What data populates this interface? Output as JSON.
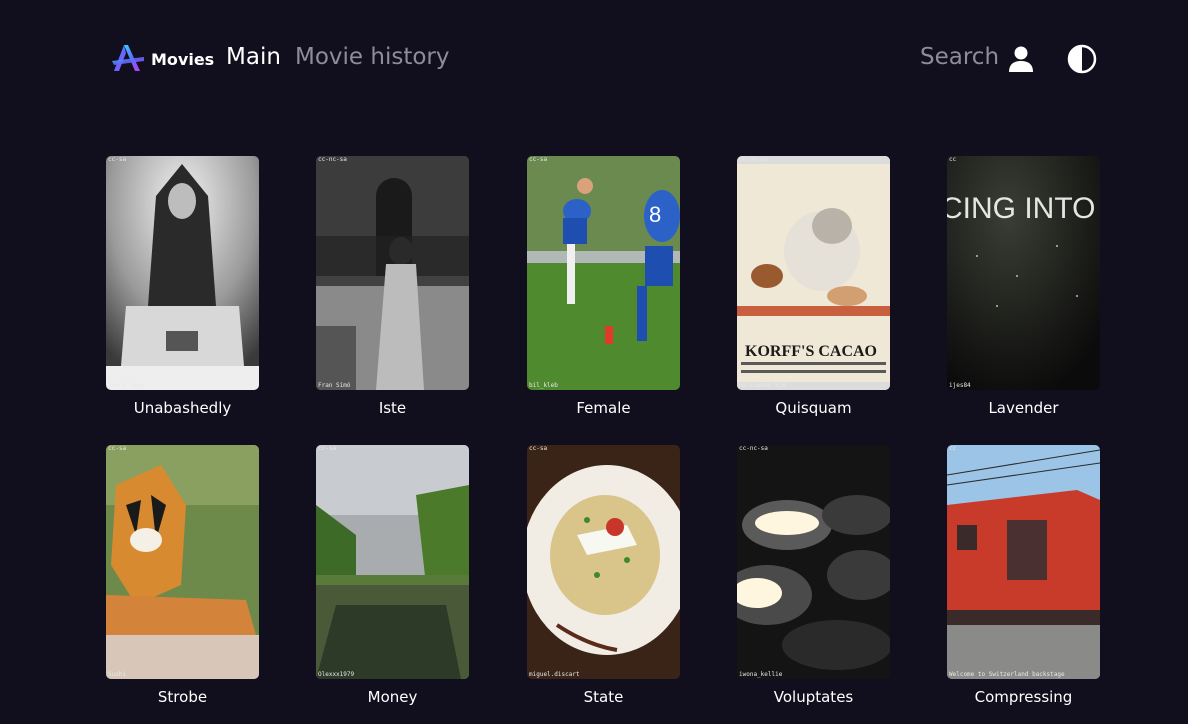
{
  "header": {
    "logo_text": "Movies",
    "nav_main": "Main",
    "nav_history": "Movie history",
    "search_label": "Search",
    "user_icon": "user-icon",
    "theme_icon": "contrast-icon"
  },
  "movies": [
    {
      "title": "Unabashedly",
      "license": "cc-sa",
      "credit": "Joe K Gage"
    },
    {
      "title": "Iste",
      "license": "cc-nc-sa",
      "credit": "Fran Simó"
    },
    {
      "title": "Female",
      "license": "cc-sa",
      "credit": "bil_kleb"
    },
    {
      "title": "Quisquam",
      "license": "cc-nc-sa",
      "credit": "Halloween HJB"
    },
    {
      "title": "Lavender",
      "license": "cc",
      "credit": "ijes84"
    },
    {
      "title": "Strobe",
      "license": "cc-sa",
      "credit": "Sushi"
    },
    {
      "title": "Money",
      "license": "cc-sa",
      "credit": "Olexxx1979"
    },
    {
      "title": "State",
      "license": "cc-sa",
      "credit": "miguel.discart"
    },
    {
      "title": "Voluptates",
      "license": "cc-nc-sa",
      "credit": "iwona_kellie"
    },
    {
      "title": "Compressing",
      "license": "cc",
      "credit": "Welcome to Switzerland backstage"
    }
  ]
}
